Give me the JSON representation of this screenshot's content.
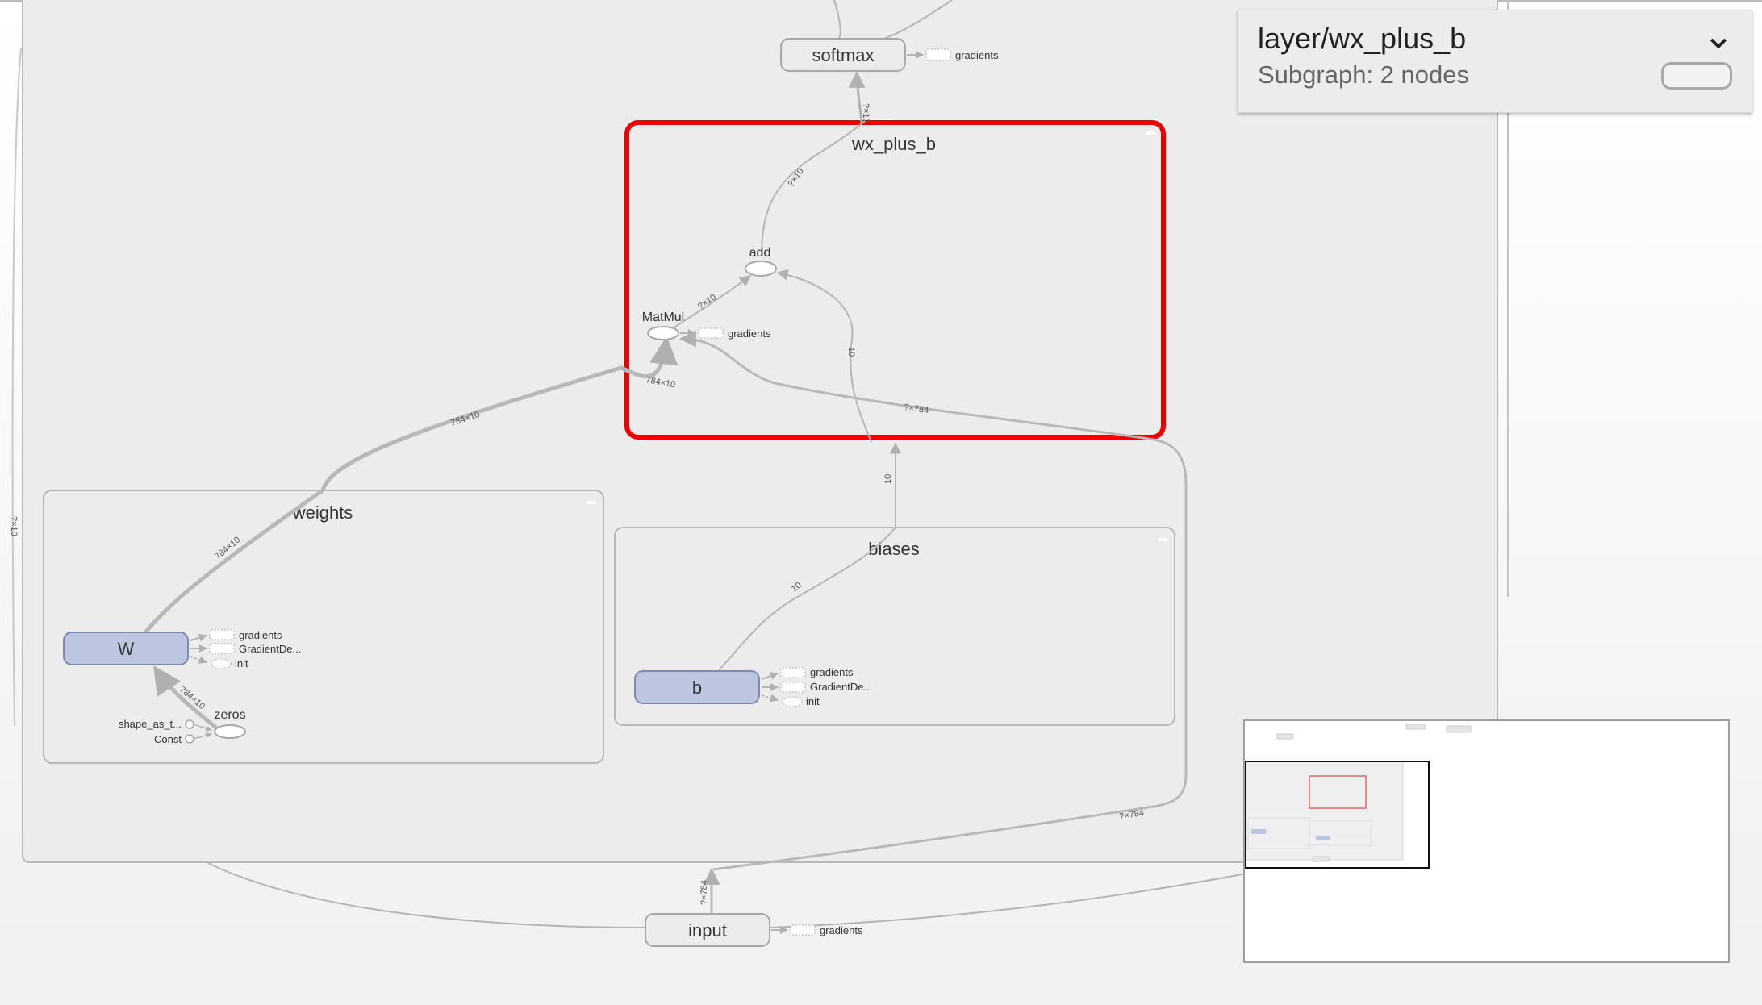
{
  "info_panel": {
    "title": "layer/wx_plus_b",
    "subtitle": "Subgraph: 2 nodes"
  },
  "nodes": {
    "softmax": "softmax",
    "wx_plus_b": "wx_plus_b",
    "add": "add",
    "matmul": "MatMul",
    "weights": "weights",
    "w": "W",
    "zeros": "zeros",
    "shape_as_tensor": "shape_as_t...",
    "const": "Const",
    "biases": "biases",
    "b": "b",
    "input": "input"
  },
  "aux": {
    "gradients": "gradients",
    "gradient_descent": "GradientDe...",
    "init": "init"
  },
  "edge_labels": {
    "softmax_in": "?×10",
    "add_out": "?×10",
    "matmul_add": "?×10",
    "bias_add": "10",
    "w_matmul_in": "784×10",
    "w_out_upper": "784×10",
    "w_out_lower": "784×10",
    "zeros_w": "784×10",
    "biases_out": "10",
    "b_out": "10",
    "input_matmul": "?×784",
    "input_right": "?×784",
    "input_up": "?×784",
    "left_side": "?×10"
  }
}
